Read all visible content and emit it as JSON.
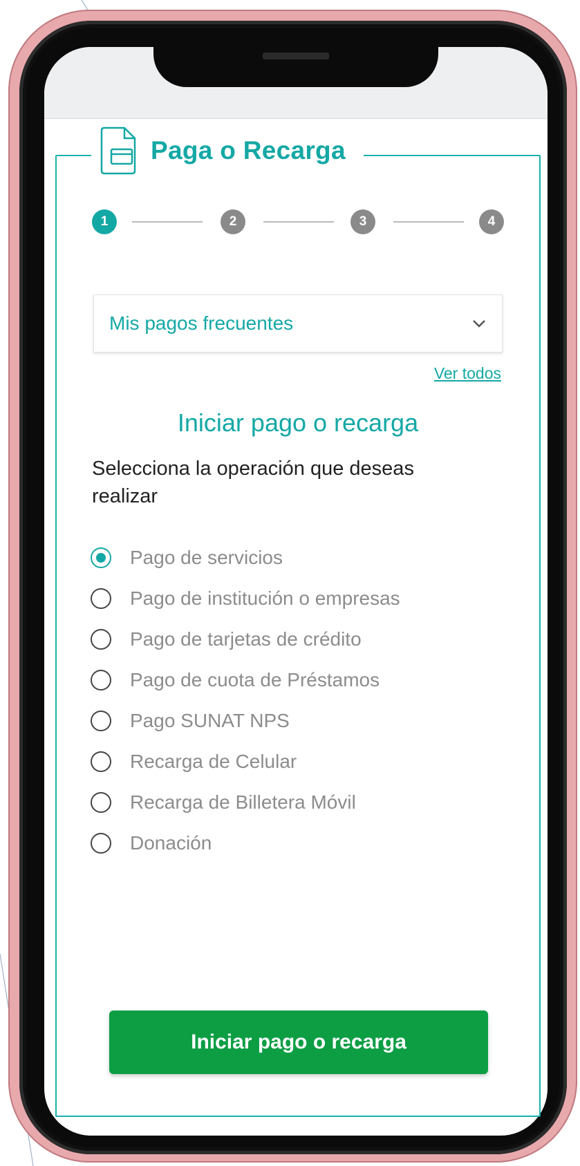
{
  "header": {
    "title": "Paga o Recarga",
    "icon": "payment-card-document-icon"
  },
  "stepper": {
    "current_step": 1,
    "steps": [
      "1",
      "2",
      "3",
      "4"
    ]
  },
  "frequent_payments": {
    "selected": "Mis pagos frecuentes",
    "see_all_link": "Ver todos"
  },
  "form": {
    "section_title": "Iniciar pago o recarga",
    "instruction": "Selecciona la operación que deseas realizar",
    "options": [
      {
        "label": "Pago de servicios",
        "selected": true
      },
      {
        "label": "Pago de institución o empresas",
        "selected": false
      },
      {
        "label": "Pago de tarjetas de crédito",
        "selected": false
      },
      {
        "label": "Pago de cuota de Préstamos",
        "selected": false
      },
      {
        "label": "Pago SUNAT NPS",
        "selected": false
      },
      {
        "label": "Recarga de Celular",
        "selected": false
      },
      {
        "label": "Recarga de Billetera Móvil",
        "selected": false
      },
      {
        "label": "Donación",
        "selected": false
      }
    ],
    "submit_label": "Iniciar pago o recarga"
  },
  "colors": {
    "accent": "#14a8a5",
    "primary_button": "#0d9e44",
    "inactive_step": "#8a8a8a",
    "phone_frame": "#e8a9ad"
  }
}
